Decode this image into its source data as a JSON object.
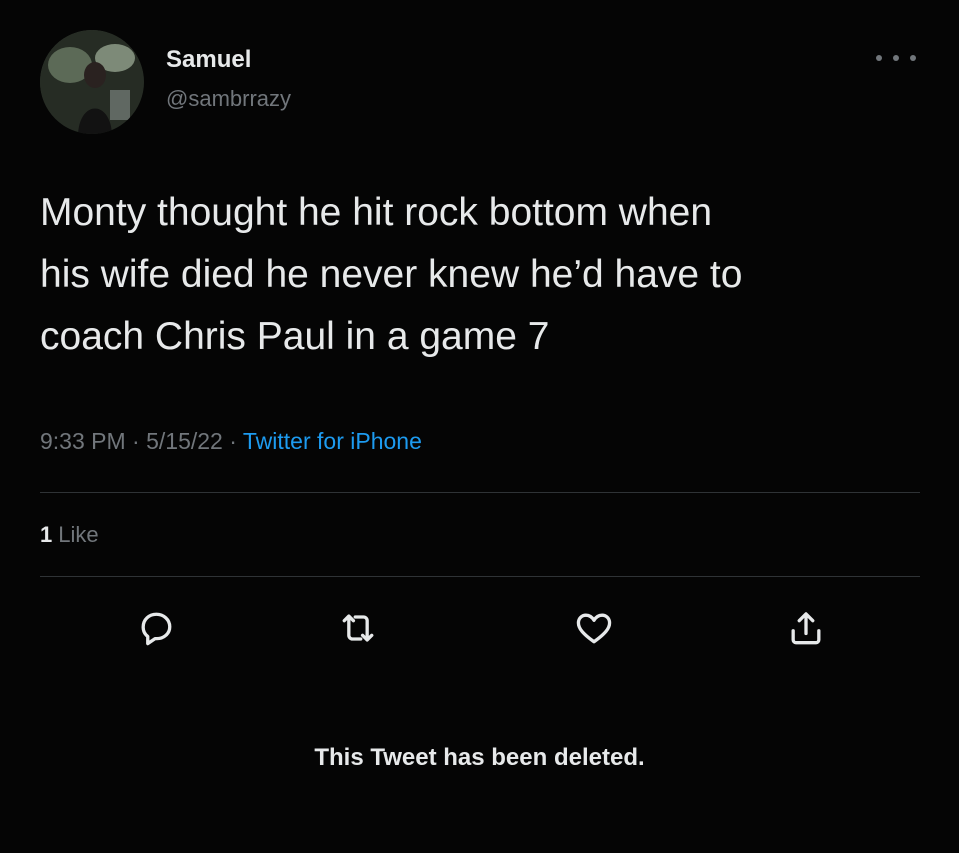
{
  "tweet": {
    "author": {
      "display_name": "Samuel",
      "handle": "@sambrrazy"
    },
    "text": "Monty thought he hit rock bottom when\nhis wife died he never knew he’d have to\ncoach Chris Paul in a game 7",
    "meta": {
      "time": "9:33 PM",
      "separator": " · ",
      "date": "5/15/22",
      "source": "Twitter for iPhone"
    },
    "stats": {
      "like_count": "1",
      "like_label": "Like"
    },
    "actions": {
      "reply_icon": "reply-icon",
      "retweet_icon": "retweet-icon",
      "like_icon": "heart-icon",
      "share_icon": "share-icon"
    },
    "deleted_notice": "This Tweet has been deleted."
  },
  "colors": {
    "background": "#050505",
    "primary_text": "#e7e9ea",
    "secondary_text": "#71767b",
    "link": "#1d9bf0",
    "divider": "#2f3336"
  }
}
